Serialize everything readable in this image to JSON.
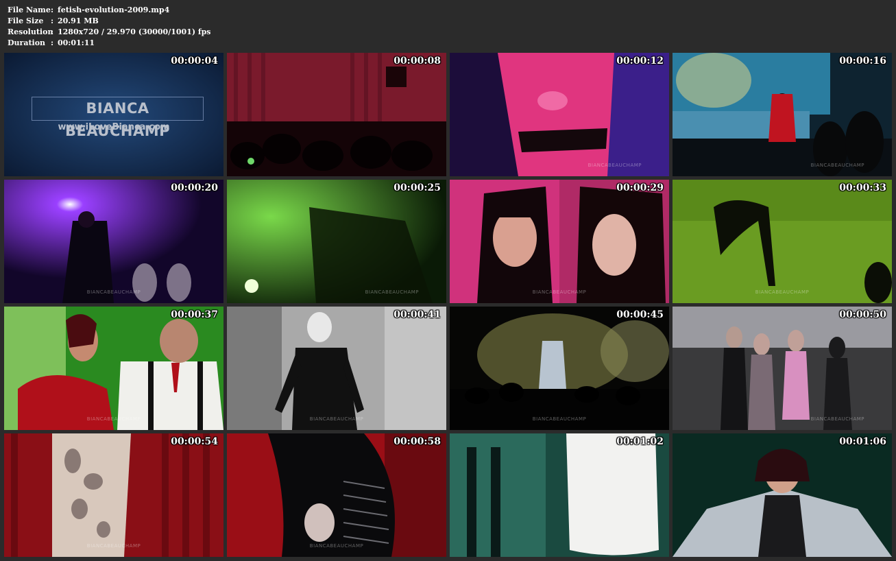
{
  "meta": {
    "rows": [
      {
        "key": "File Name",
        "sep": ":",
        "value": "fetish-evolution-2009.mp4"
      },
      {
        "key": "File Size",
        "sep": ":",
        "value": "20.91 MB"
      },
      {
        "key": "Resolution",
        "sep": ":",
        "value": "1280x720 / 29.970 (30000/1001) fps"
      },
      {
        "key": "Duration",
        "sep": ":",
        "value": "00:01:11"
      }
    ]
  },
  "brand": {
    "name": "BIANCA BEAUCHAMP",
    "url": "www.iLoveBianca.com"
  },
  "watermark": "BIANCABEAUCHAMP",
  "thumbnails": [
    {
      "timestamp": "00:00:04"
    },
    {
      "timestamp": "00:00:08"
    },
    {
      "timestamp": "00:00:12"
    },
    {
      "timestamp": "00:00:16"
    },
    {
      "timestamp": "00:00:20"
    },
    {
      "timestamp": "00:00:25"
    },
    {
      "timestamp": "00:00:29"
    },
    {
      "timestamp": "00:00:33"
    },
    {
      "timestamp": "00:00:37"
    },
    {
      "timestamp": "00:00:41"
    },
    {
      "timestamp": "00:00:45"
    },
    {
      "timestamp": "00:00:50"
    },
    {
      "timestamp": "00:00:54"
    },
    {
      "timestamp": "00:00:58"
    },
    {
      "timestamp": "00:01:02"
    },
    {
      "timestamp": "00:01:06"
    }
  ]
}
